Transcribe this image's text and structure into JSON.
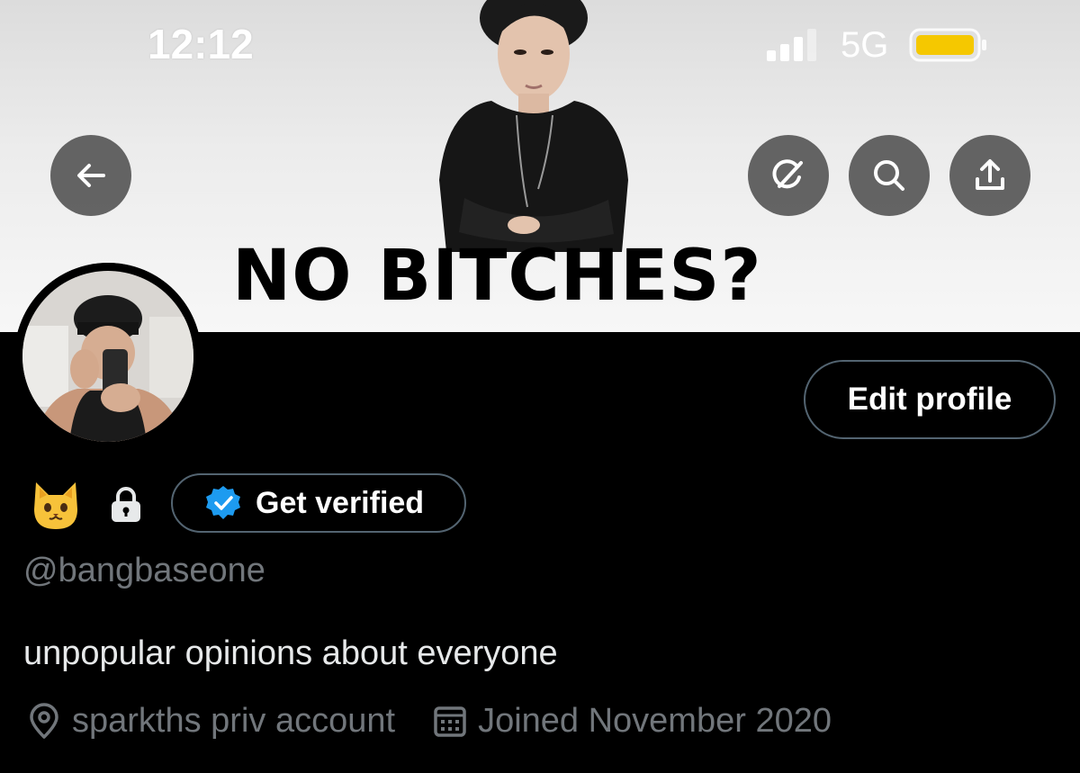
{
  "status_bar": {
    "time": "12:12",
    "network": "5G",
    "battery_color": "#f5c800"
  },
  "banner": {
    "caption": "NO BITCHES?"
  },
  "nav": {
    "back_icon": "arrow-left-icon",
    "grok_icon": "grok-icon",
    "search_icon": "search-icon",
    "share_icon": "share-icon"
  },
  "profile": {
    "edit_label": "Edit profile",
    "name_emoji": "cat-face",
    "get_verified_label": "Get verified",
    "handle": "@bangbaseone",
    "bio": "unpopular opinions about everyone",
    "location": "sparkths priv account",
    "joined": "Joined November 2020"
  },
  "colors": {
    "background": "#000000",
    "border": "#536471",
    "muted_text": "#71767b",
    "verified_blue": "#1d9bf0"
  }
}
